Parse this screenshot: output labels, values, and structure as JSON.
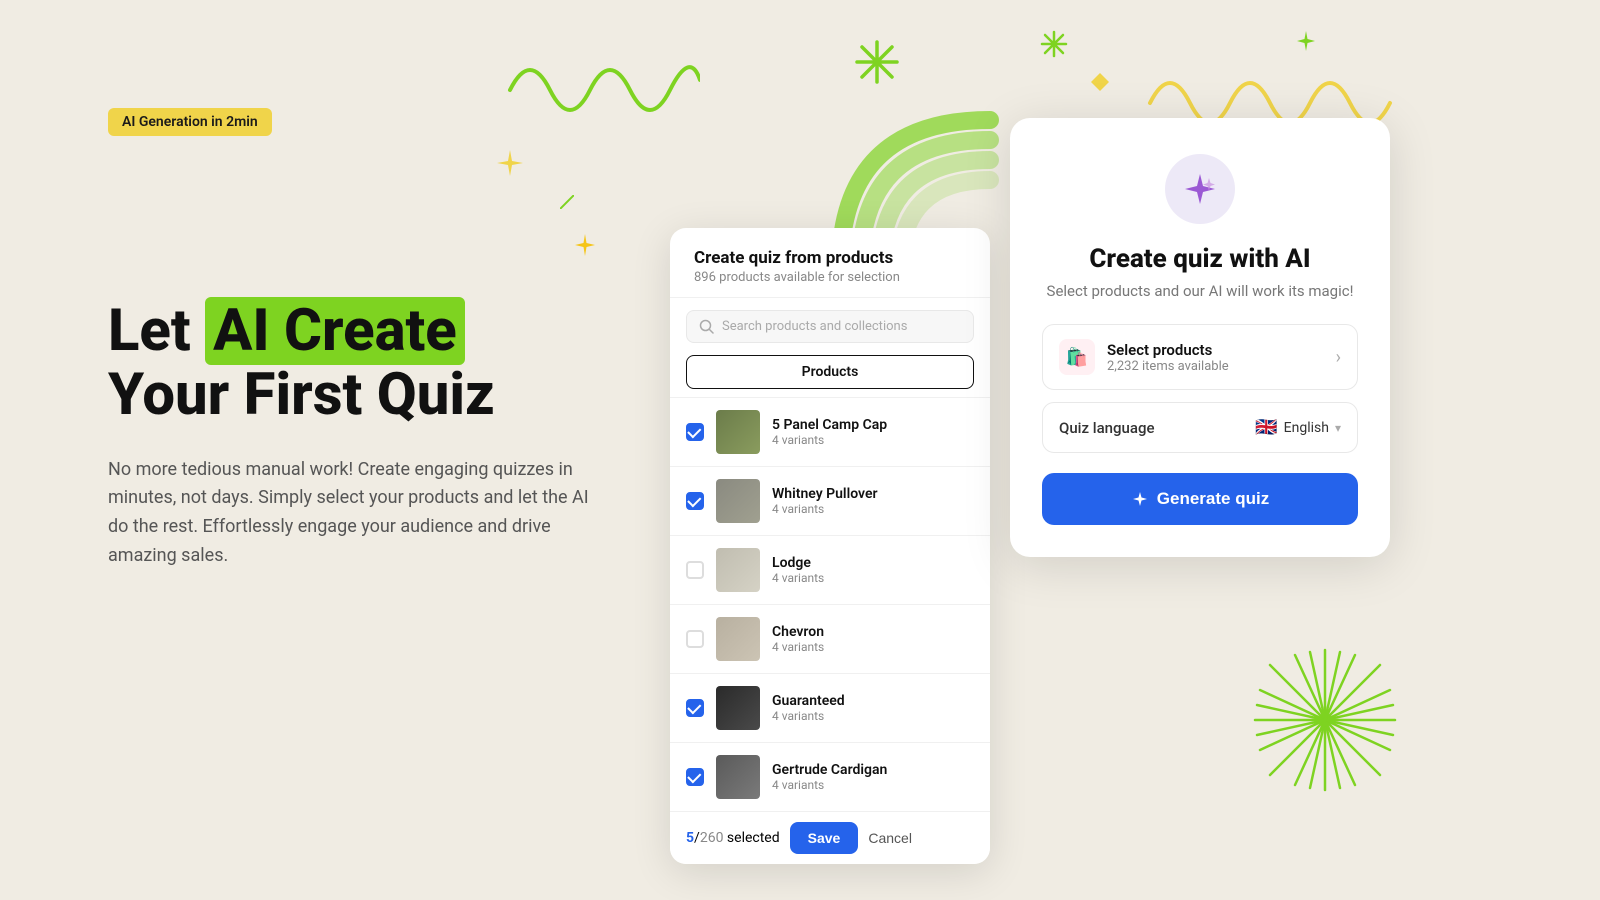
{
  "badge": {
    "label": "AI Generation in 2min"
  },
  "hero": {
    "heading_before": "Let ",
    "heading_highlight": "AI Create",
    "heading_after": "Your First Quiz",
    "subtext": "No more tedious manual work! Create engaging quizzes in minutes, not days. Simply select your products and let the AI do the rest. Effortlessly engage your audience and drive amazing sales."
  },
  "quiz_modal": {
    "title": "Create quiz from products",
    "subtitle": "896 products available for selection",
    "search_placeholder": "Search products and collections",
    "tab_products": "Products",
    "products": [
      {
        "name": "5 Panel Camp Cap",
        "variants": "4 variants",
        "checked": true,
        "thumb": "cap"
      },
      {
        "name": "Whitney Pullover",
        "variants": "4 variants",
        "checked": true,
        "thumb": "pullover"
      },
      {
        "name": "Lodge",
        "variants": "4 variants",
        "checked": false,
        "thumb": "lodge"
      },
      {
        "name": "Chevron",
        "variants": "4 variants",
        "checked": false,
        "thumb": "chevron"
      },
      {
        "name": "Guaranteed",
        "variants": "4 variants",
        "checked": true,
        "thumb": "guaranteed"
      },
      {
        "name": "Gertrude Cardigan",
        "variants": "4 variants",
        "checked": true,
        "thumb": "gertrude"
      }
    ],
    "footer": {
      "selected": "5",
      "total": "260",
      "selected_label": "selected",
      "save_btn": "Save",
      "cancel_btn": "Cancel"
    }
  },
  "ai_modal": {
    "title": "Create quiz with AI",
    "subtitle": "Select products and our AI will work its magic!",
    "select_products_label": "Select products",
    "select_products_sub": "2,232 items available",
    "language_label": "Quiz language",
    "language_value": "English",
    "generate_btn": "Generate quiz"
  }
}
